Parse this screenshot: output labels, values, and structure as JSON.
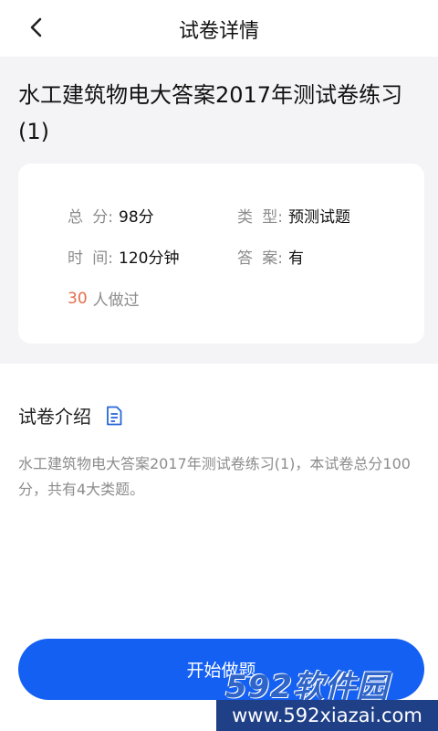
{
  "navbar": {
    "back_icon": "chevron-left-icon",
    "title": "试卷详情"
  },
  "exam": {
    "title": "水工建筑物电大答案2017年测试卷练习(1)"
  },
  "info": {
    "score_label_a": "总",
    "score_label_b": "分:",
    "score_value": "98分",
    "type_label_a": "类",
    "type_label_b": "型:",
    "type_value": "预测试题",
    "time_label_a": "时",
    "time_label_b": "间:",
    "time_value": "120分钟",
    "answer_label_a": "答",
    "answer_label_b": "案:",
    "answer_value": "有",
    "done_count": "30",
    "done_text": "人做过"
  },
  "intro": {
    "title": "试卷介绍",
    "icon": "document-icon",
    "text": "水工建筑物电大答案2017年测试卷练习(1)，本试卷总分100分，共有4大类题。"
  },
  "start_button": {
    "label": "开始做题"
  },
  "watermark": {
    "brand": "592软件园",
    "url": "www.592xiazai.com"
  },
  "colors": {
    "accent": "#1460f2",
    "count": "#e46d4a",
    "section_bg": "#f4f4f6"
  }
}
